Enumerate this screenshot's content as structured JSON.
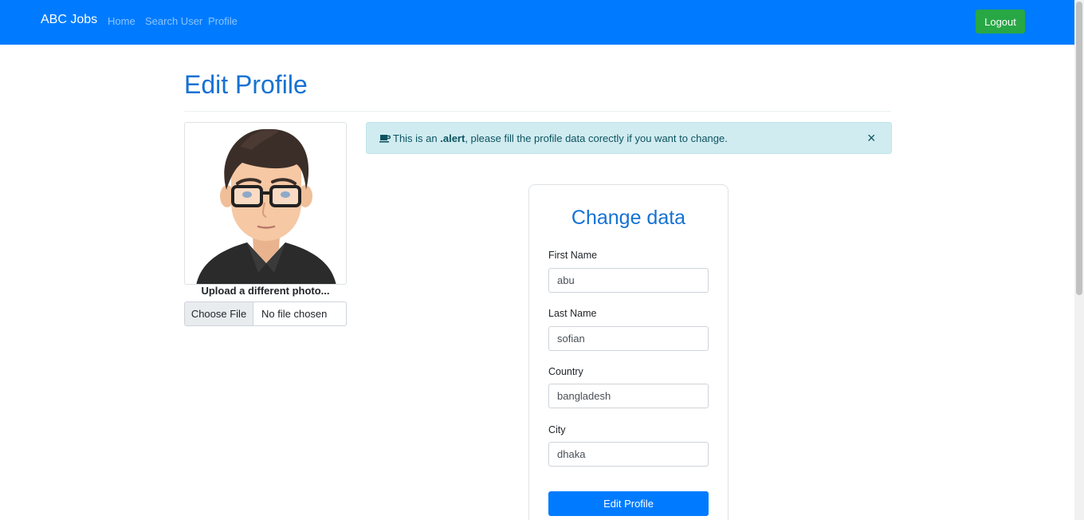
{
  "navbar": {
    "brand": "ABC Jobs",
    "links": [
      "Home",
      "Search User",
      "Profile"
    ],
    "logout_label": "Logout",
    "bg_color": "#007bff",
    "logout_color": "#28a745"
  },
  "page": {
    "title": "Edit Profile"
  },
  "photo": {
    "upload_label": "Upload a different photo...",
    "choose_file_label": "Choose File",
    "no_file_text": "No file chosen"
  },
  "alert": {
    "icon": "coffee-icon",
    "prefix": "This is an ",
    "bold": ".alert",
    "suffix": ", please fill the profile data corectly if you want to change.",
    "close_symbol": "×"
  },
  "form": {
    "title": "Change data",
    "fields": [
      {
        "label": "First Name",
        "value": "abu"
      },
      {
        "label": "Last Name",
        "value": "sofian"
      },
      {
        "label": "Country",
        "value": "bangladesh"
      },
      {
        "label": "City",
        "value": "dhaka"
      }
    ],
    "submit_label": "Edit Profile"
  }
}
